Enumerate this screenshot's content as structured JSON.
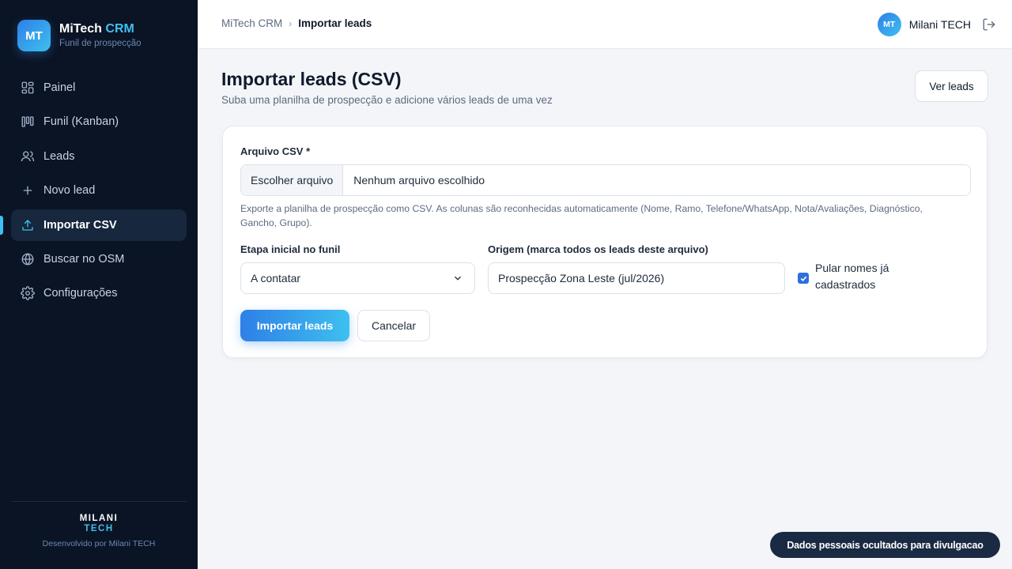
{
  "brand": {
    "initials": "MT",
    "name": "MiTech",
    "name_accent": "CRM",
    "tagline": "Funil de prospecção"
  },
  "nav": {
    "items": [
      {
        "label": "Painel",
        "icon": "dashboard-icon",
        "active": false
      },
      {
        "label": "Funil (Kanban)",
        "icon": "kanban-icon",
        "active": false
      },
      {
        "label": "Leads",
        "icon": "users-icon",
        "active": false
      },
      {
        "label": "Novo lead",
        "icon": "plus-icon",
        "active": false
      },
      {
        "label": "Importar CSV",
        "icon": "upload-icon",
        "active": true
      },
      {
        "label": "Buscar no OSM",
        "icon": "globe-icon",
        "active": false
      },
      {
        "label": "Configurações",
        "icon": "gear-icon",
        "active": false
      }
    ]
  },
  "sidebar_footer": {
    "logo_line1": "MILANI",
    "logo_line2": "TECH",
    "credit": "Desenvolvido por Milani TECH"
  },
  "breadcrumb": {
    "root": "MiTech CRM",
    "separator": "›",
    "current": "Importar leads"
  },
  "user": {
    "initials": "MT",
    "name": "Milani TECH"
  },
  "page": {
    "title": "Importar leads (CSV)",
    "subtitle": "Suba uma planilha de prospecção e adicione vários leads de uma vez",
    "view_leads_label": "Ver leads"
  },
  "form": {
    "file_label": "Arquivo CSV *",
    "file_button": "Escolher arquivo",
    "file_status": "Nenhum arquivo escolhido",
    "help_text": "Exporte a planilha de prospecção como CSV. As colunas são reconhecidas automaticamente (Nome, Ramo, Telefone/WhatsApp, Nota/Avaliações, Diagnóstico, Gancho, Grupo).",
    "stage_label": "Etapa inicial no funil",
    "stage_value": "A contatar",
    "origin_label": "Origem (marca todos os leads deste arquivo)",
    "origin_value": "Prospecção Zona Leste (jul/2026)",
    "skip_label": "Pular nomes já cadastrados",
    "skip_checked": true,
    "submit_label": "Importar leads",
    "cancel_label": "Cancelar"
  },
  "toast": {
    "text": "Dados pessoais ocultados para divulgacao"
  },
  "colors": {
    "sidebar_bg": "#0b1424",
    "accent": "#3ec0f0",
    "primary": "#2f7fe6",
    "page_bg": "#f3f5f9"
  }
}
